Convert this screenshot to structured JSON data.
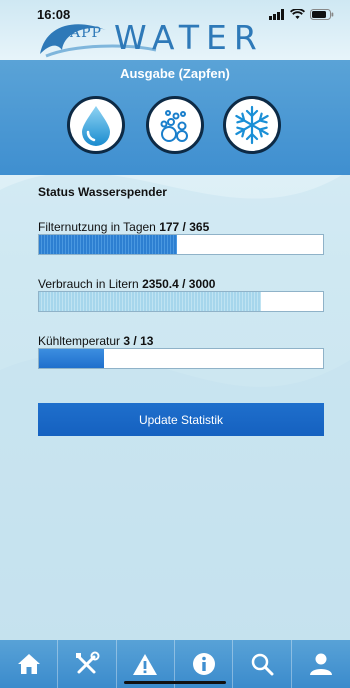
{
  "status_bar": {
    "time": "16:08"
  },
  "logo": {
    "app_text": "APP",
    "water_text": "WATER"
  },
  "band": {
    "title": "Ausgabe (Zapfen)"
  },
  "mode_buttons": [
    {
      "icon": "water-drop-icon"
    },
    {
      "icon": "bubbles-icon"
    },
    {
      "icon": "snowflake-icon"
    }
  ],
  "status": {
    "title": "Status Wasserspender",
    "stats": [
      {
        "label": "Filternutzung in Tagen ",
        "value": "177 / 365",
        "fraction": 0.485
      },
      {
        "label": "Verbrauch in Litern ",
        "value": "2350.4 / 3000",
        "fraction": 0.78
      },
      {
        "label": "Kühltemperatur ",
        "value": "3 / 13",
        "fraction": 0.23
      }
    ]
  },
  "update_button": {
    "label": "Update Statistik"
  },
  "nav": [
    {
      "icon": "home-icon"
    },
    {
      "icon": "tools-icon"
    },
    {
      "icon": "warning-icon"
    },
    {
      "icon": "info-icon"
    },
    {
      "icon": "search-icon"
    },
    {
      "icon": "user-icon"
    }
  ],
  "colors": {
    "accent": "#1f6fcc",
    "band": "#4a98d4",
    "nav": "#4a94d0"
  }
}
